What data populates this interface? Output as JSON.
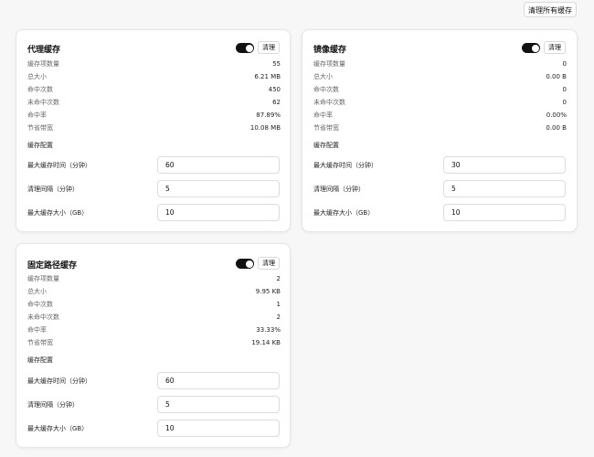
{
  "toolbar": {
    "clear_all_label": "清理所有缓存"
  },
  "cards": [
    {
      "title": "代理缓存",
      "clear_label": "清理",
      "enabled": true,
      "stats": [
        {
          "label": "缓存项数量",
          "value": "55"
        },
        {
          "label": "总大小",
          "value": "6.21 MB"
        },
        {
          "label": "命中次数",
          "value": "450"
        },
        {
          "label": "未命中次数",
          "value": "62"
        },
        {
          "label": "命中率",
          "value": "87.89%"
        },
        {
          "label": "节省带宽",
          "value": "10.08 MB"
        }
      ],
      "config_title": "缓存配置",
      "config": [
        {
          "label": "最大缓存时间（分钟）",
          "value": "60"
        },
        {
          "label": "清理间隔（分钟）",
          "value": "5"
        },
        {
          "label": "最大缓存大小（GB）",
          "value": "10"
        }
      ]
    },
    {
      "title": "镜像缓存",
      "clear_label": "清理",
      "enabled": true,
      "stats": [
        {
          "label": "缓存项数量",
          "value": "0"
        },
        {
          "label": "总大小",
          "value": "0.00 B"
        },
        {
          "label": "命中次数",
          "value": "0"
        },
        {
          "label": "未命中次数",
          "value": "0"
        },
        {
          "label": "命中率",
          "value": "0.00%"
        },
        {
          "label": "节省带宽",
          "value": "0.00 B"
        }
      ],
      "config_title": "缓存配置",
      "config": [
        {
          "label": "最大缓存时间（分钟）",
          "value": "30"
        },
        {
          "label": "清理间隔（分钟）",
          "value": "5"
        },
        {
          "label": "最大缓存大小（GB）",
          "value": "10"
        }
      ]
    },
    {
      "title": "固定路径缓存",
      "clear_label": "清理",
      "enabled": true,
      "stats": [
        {
          "label": "缓存项数量",
          "value": "2"
        },
        {
          "label": "总大小",
          "value": "9.95 KB"
        },
        {
          "label": "命中次数",
          "value": "1"
        },
        {
          "label": "未命中次数",
          "value": "2"
        },
        {
          "label": "命中率",
          "value": "33.33%"
        },
        {
          "label": "节省带宽",
          "value": "19.14 KB"
        }
      ],
      "config_title": "缓存配置",
      "config": [
        {
          "label": "最大缓存时间（分钟）",
          "value": "60"
        },
        {
          "label": "清理间隔（分钟）",
          "value": "5"
        },
        {
          "label": "最大缓存大小（GB）",
          "value": "10"
        }
      ]
    }
  ]
}
